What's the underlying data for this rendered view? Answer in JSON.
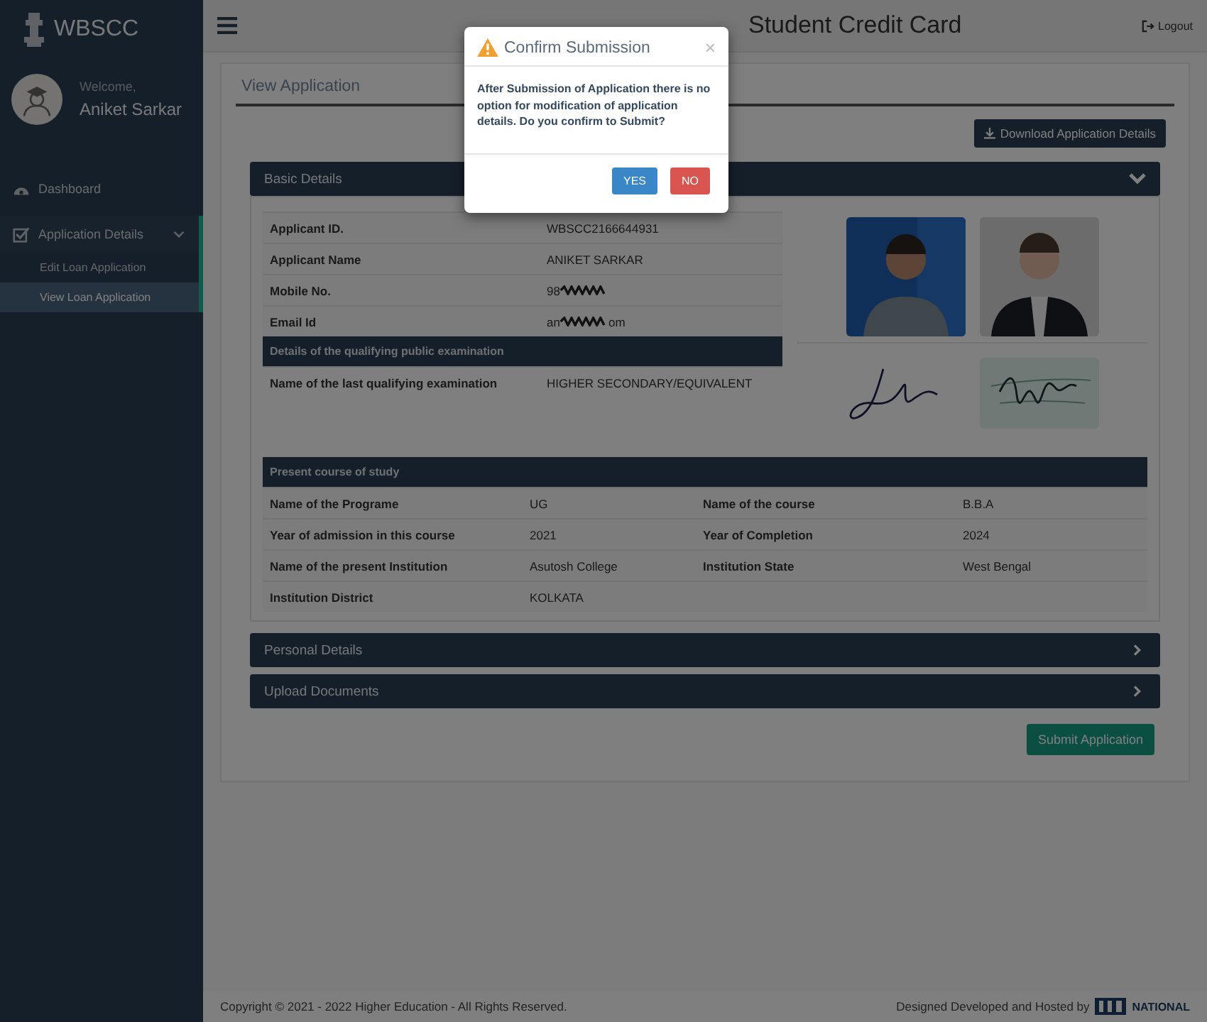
{
  "brand": "WBSCC",
  "user": {
    "greeting": "Welcome,",
    "name": "Aniket Sarkar"
  },
  "nav": [
    {
      "label": "Dashboard"
    },
    {
      "label": "Application Details",
      "expanded": true,
      "children": [
        {
          "label": "Edit Loan Application",
          "selected": false
        },
        {
          "label": "View Loan Application",
          "selected": true
        }
      ]
    }
  ],
  "header": {
    "title": "Student Credit Card",
    "logout": "Logout"
  },
  "page": {
    "title": "View Application",
    "download": "Download Application Details"
  },
  "sections": [
    {
      "title": "Basic Details",
      "expanded": true
    },
    {
      "title": "Personal Details",
      "expanded": false
    },
    {
      "title": "Upload Documents",
      "expanded": false
    }
  ],
  "basic": {
    "rows": [
      {
        "label": "Applicant ID.",
        "value": "WBSCC2166644931"
      },
      {
        "label": "Applicant Name",
        "value": "ANIKET SARKAR"
      },
      {
        "label": "Mobile No.",
        "value": "98",
        "masked": true
      },
      {
        "label": "Email Id",
        "value": "an",
        "masked": true,
        "value_tail": "om"
      }
    ],
    "exam_heading": "Details of the qualifying public examination",
    "exam_rows": [
      {
        "label": "Name of the last qualifying examination",
        "value": "HIGHER SECONDARY/EQUIVALENT"
      }
    ]
  },
  "course": {
    "heading": "Present course of study",
    "rows": [
      [
        {
          "label": "Name of the Programe",
          "value": "UG"
        },
        {
          "label": "Name of the course",
          "value": "B.B.A"
        }
      ],
      [
        {
          "label": "Year of admission in this course",
          "value": "2021"
        },
        {
          "label": "Year of Completion",
          "value": "2024"
        }
      ],
      [
        {
          "label": "Name of the present Institution",
          "value": "Asutosh College"
        },
        {
          "label": "Institution State",
          "value": "West Bengal"
        }
      ],
      [
        {
          "label": "Institution District",
          "value": "KOLKATA"
        }
      ]
    ]
  },
  "submit": "Submit Application",
  "footer": {
    "copyright": "Copyright © 2021 - 2022 Higher Education - All Rights Reserved.",
    "credit": "Designed Developed and Hosted by",
    "logo_text": "NATIONAL"
  },
  "modal": {
    "title": "Confirm Submission",
    "close": "×",
    "message": "After Submission of Application there is no option for modification of application details. Do you confirm to Submit?",
    "buttons": [
      {
        "label": "YES",
        "kind": "primary"
      },
      {
        "label": "NO",
        "kind": "danger"
      }
    ]
  }
}
